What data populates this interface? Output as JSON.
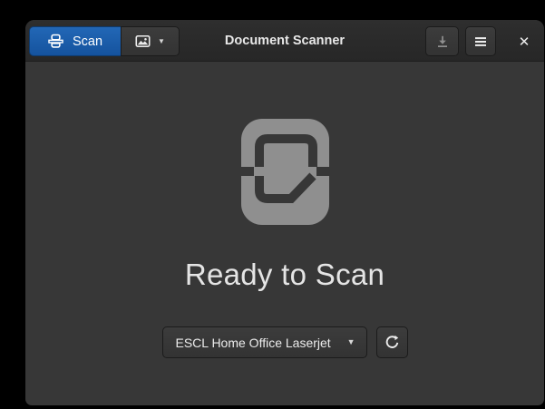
{
  "window": {
    "title": "Document Scanner"
  },
  "header": {
    "scan_label": "Scan"
  },
  "content": {
    "status_heading": "Ready to Scan",
    "scanner_name": "ESCL Home Office Laserjet"
  },
  "icons": {
    "scan_button_icon": "flatbed-scanner",
    "scan_type_icon": "image-photo",
    "dropdown_arrow": "▼",
    "save_icon": "download-arrow-into-tray",
    "menu_icon": "hamburger-menu",
    "close_glyph": "✕",
    "ready_icon": "scanner-plate-with-document",
    "refresh_icon": "circular-arrow-clockwise"
  },
  "colors": {
    "accent": "#15539e",
    "header_bg": "#2b2b2b",
    "window_bg": "#373737",
    "button_bg": "#383838",
    "icon_gray": "#8f8f8f",
    "text_light": "#ececec"
  }
}
